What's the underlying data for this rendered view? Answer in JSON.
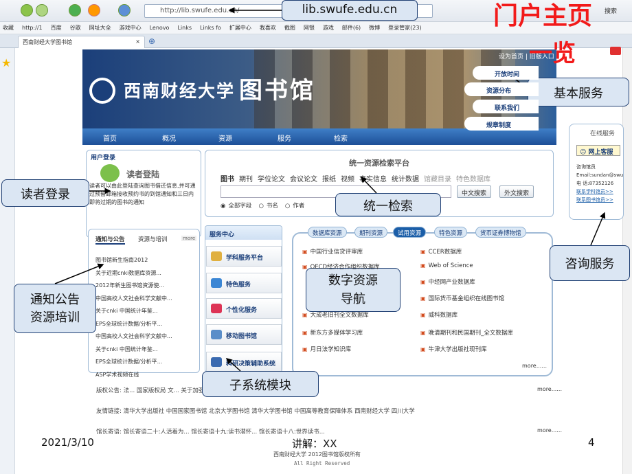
{
  "browser": {
    "address": "http://lib.swufe.edu.cn/",
    "search_label": "搜索",
    "favorites": [
      "收藏",
      "http://1",
      "百度",
      "谷歌",
      "网址大全",
      "游戏中心",
      "Lenovo",
      "Links",
      "Links fo",
      "扩展中心",
      "我喜欢",
      "截图",
      "网银",
      "游戏",
      "邮件(6)",
      "微博",
      "登录管家(23)"
    ],
    "tab_title": "西南财经大学图书馆"
  },
  "site": {
    "school_name": "西南财经大学",
    "lib_name": "图书馆",
    "top_links": "设为首页 | 旧版入口",
    "right_services": [
      "开放时间",
      "资源分布",
      "联系我们",
      "规章制度"
    ],
    "nav": [
      "首页",
      "概况",
      "资源",
      "服务",
      "检索"
    ],
    "login": {
      "title": "用户登录",
      "heading": "读者登陆",
      "text": "读者可以由此登陆查询图书借还信息,并可通过预留邮箱接收预约书的到馆通知和三日内即将过期的图书的通知"
    },
    "search": {
      "title": "统一资源检索平台",
      "types": [
        "图书",
        "期刊",
        "学位论文",
        "会议论文",
        "报纸",
        "视频",
        "事实信息",
        "统计数据",
        "馆藏目录",
        "特色数据库"
      ],
      "btn_cn": "中文搜索",
      "btn_en": "外文搜索",
      "fields": [
        "全部字段",
        "书名",
        "作者"
      ]
    },
    "notice": {
      "tabs": [
        "通知与公告",
        "资源与培训"
      ],
      "more": "more",
      "items": [
        "图书馆新生指南2012",
        "关于近期cnki数据库资源...",
        "2012年新生图书馆资源使...",
        "中国高校人文社会科学文献中...",
        "关于cnki 中国统计年鉴...",
        "EPS全球统计数据/分析平...",
        "中国高校人文社会科学文献中...",
        "关于cnki 中国统计年鉴...",
        "EPS全球统计数据/分析平...",
        "ASP学术视频在线"
      ]
    },
    "service_center": {
      "title": "服务中心",
      "items": [
        "学科服务平台",
        "特色服务",
        "个性化服务",
        "移动图书馆",
        "科研决策辅助系统"
      ]
    },
    "db_tabs": [
      "数据库资源",
      "期刊资源",
      "试用资源",
      "特色资源",
      "货币证券博物馆"
    ],
    "db_left": [
      "中国行业信贷评审库",
      "OECD经济合作组织数据库",
      "",
      "",
      "大成老旧刊全文数据库",
      "新东方多媒体学习库",
      "月日法学知识库"
    ],
    "db_right": [
      "CCER数据库",
      "Web of Science",
      "中经网产业数据库",
      "国际货币基金组织在线图书馆",
      "威科数据库",
      "晚清期刊和民国期刊_全文数据库",
      "牛津大学出版社现刊库"
    ],
    "db_more": "more......",
    "online": {
      "title": "在线服务",
      "btn": "网上客服",
      "text": [
        "咨询馆员",
        "Email:sundan@swu...",
        "电 话:87352126",
        "联系学科馆员>>",
        "联系图书馆员>>"
      ]
    },
    "footer": {
      "copyright": "版权公告: 法...    国家版权局 文...                              关于加强图书馆著作权保...    西南财经大学图书",
      "links": "友情链接:  清华大学出版社   中国国家图书馆   北京大学图书馆   清华大学图书馆   中国高等教育保障体系   西南财经大学   四川大学",
      "words": "馆长寄语:      馆长寄语二十:人活着为...        馆长寄语十九:读书潜怀...        馆长寄语十八:世界读书...",
      "more": "more......",
      "bottom1": "西南财经大学   2012图书馆版权所有",
      "bottom2": "All Right Reserved"
    }
  },
  "callouts": {
    "url": "lib.swufe.edu.cn",
    "basic": "基本服务",
    "reader": "读者登录",
    "search": "统一检索",
    "notice": "通知公告\n资源培训",
    "digital": "数字资源\n导航",
    "consult": "咨询服务",
    "subsystem": "子系统模块"
  },
  "slide": {
    "title_red": "门户主页",
    "title_red2": "一览",
    "date": "2021/3/10",
    "speaker": "讲解：XX",
    "page": "4"
  }
}
